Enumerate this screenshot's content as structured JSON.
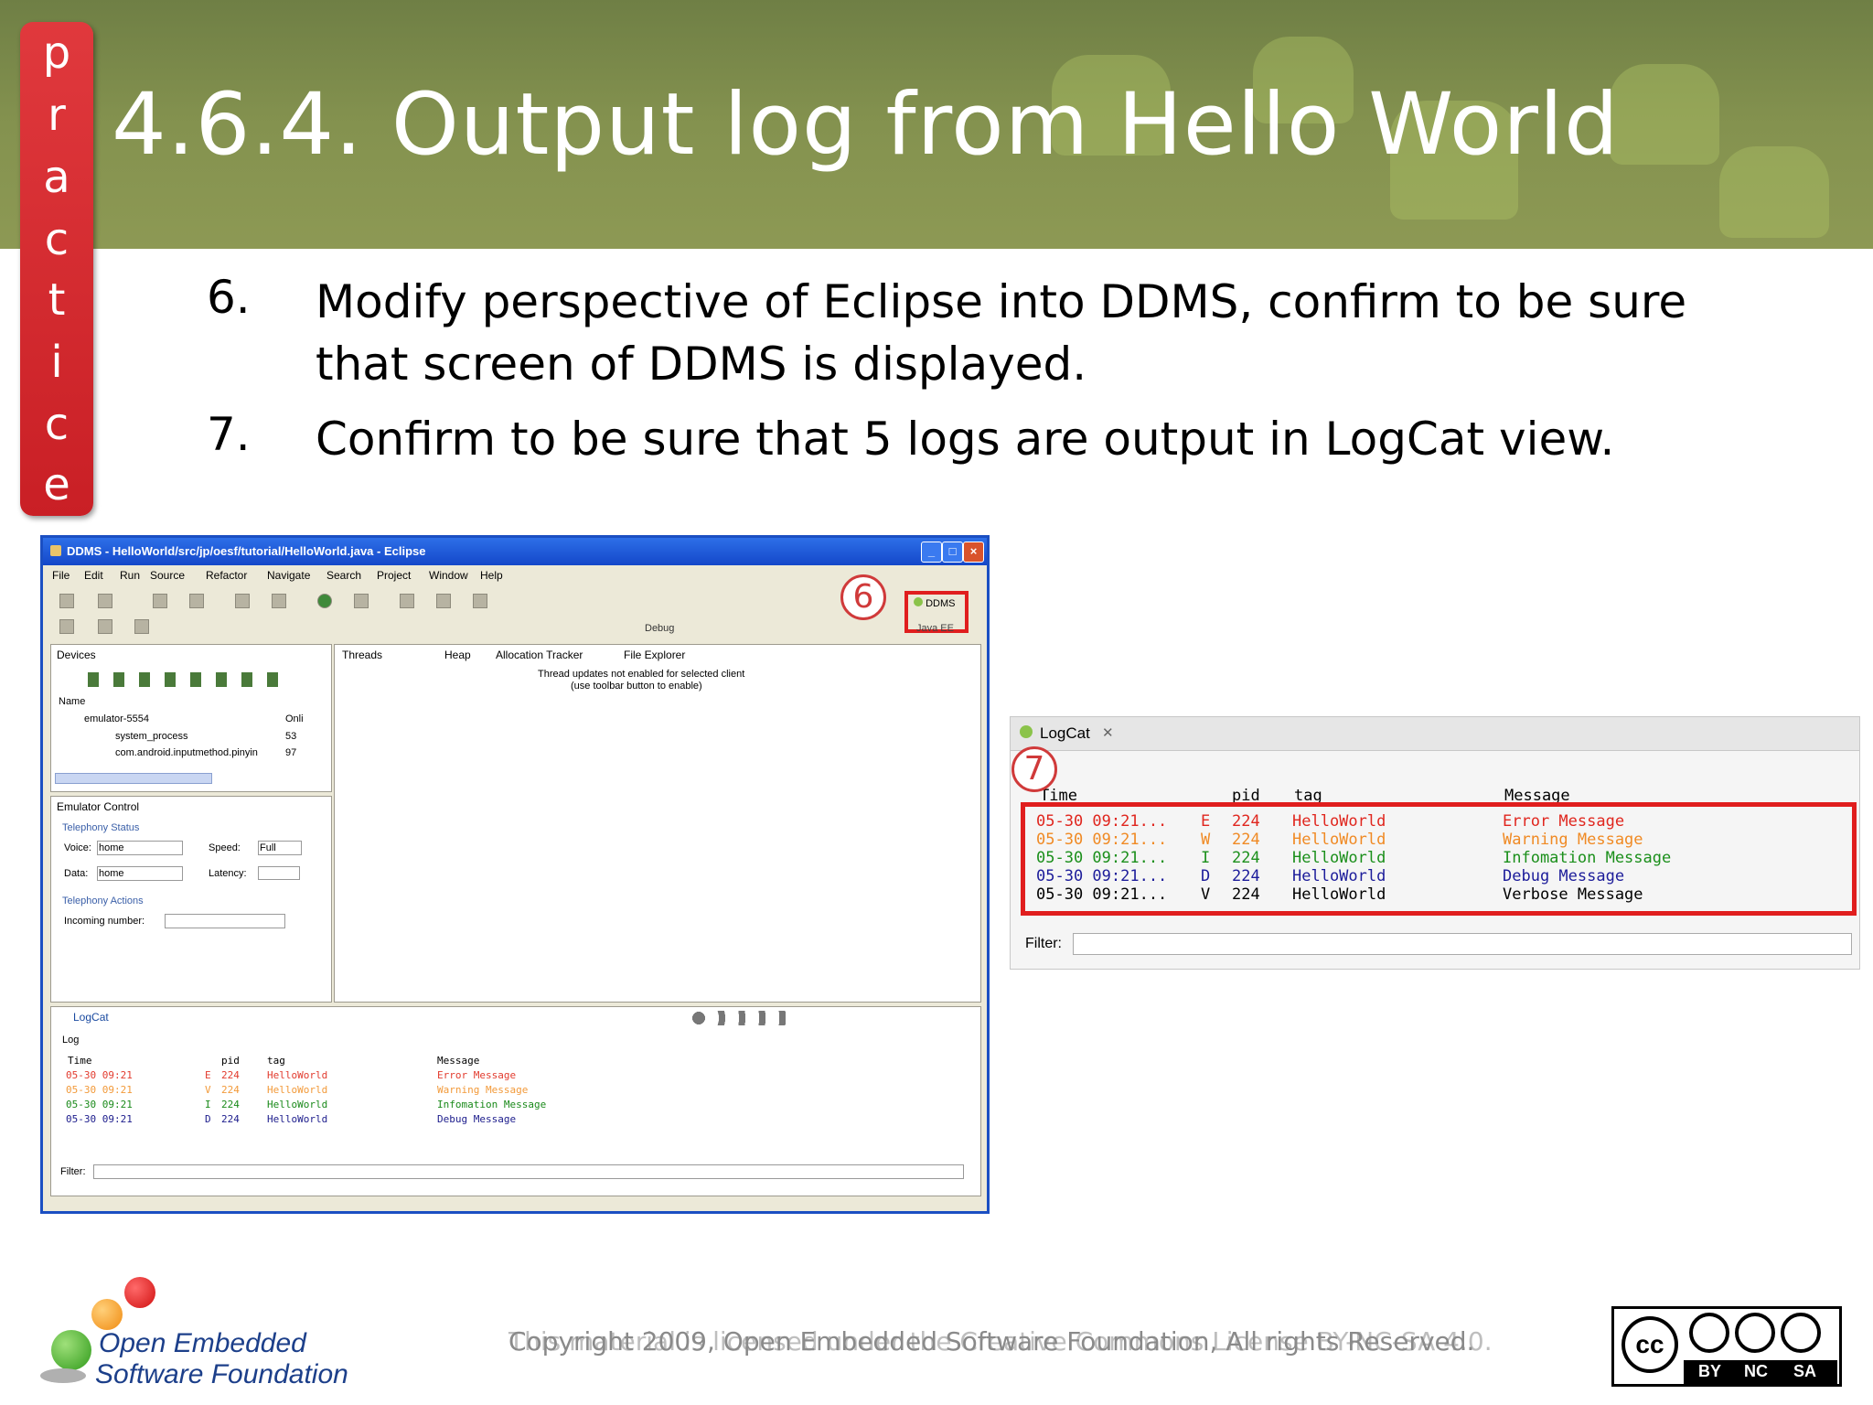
{
  "slide": {
    "title": "4.6.4. Output log from Hello World",
    "practice_letters": [
      "p",
      "r",
      "a",
      "c",
      "t",
      "i",
      "c",
      "e"
    ]
  },
  "steps": [
    {
      "num": "6.",
      "text": "Modify perspective of Eclipse into DDMS, confirm to be sure that screen of DDMS is displayed."
    },
    {
      "num": "7.",
      "text": "Confirm to be sure that 5 logs are output in LogCat view."
    }
  ],
  "eclipse": {
    "title": "DDMS - HelloWorld/src/jp/oesf/tutorial/HelloWorld.java - Eclipse",
    "menu": [
      "File",
      "Edit",
      "Run",
      "Source",
      "Refactor",
      "Navigate",
      "Search",
      "Project",
      "Window",
      "Help"
    ],
    "perspective": {
      "ddms": "DDMS",
      "debug": "Debug",
      "java": "Java EE"
    },
    "devices": {
      "tab": "Devices",
      "col_name": "Name",
      "rows": [
        {
          "name": "emulator-5554",
          "value": "Onli"
        },
        {
          "name": "system_process",
          "value": "53"
        },
        {
          "name": "com.android.inputmethod.pinyin",
          "value": "97"
        }
      ]
    },
    "right_tabs": [
      "Threads",
      "Heap",
      "Allocation Tracker",
      "File Explorer"
    ],
    "threads_msg": [
      "Thread updates not enabled for selected client",
      "(use toolbar button to enable)"
    ],
    "emulator": {
      "tab": "Emulator Control",
      "telephony_status": "Telephony Status",
      "voice_label": "Voice:",
      "voice_value": "home",
      "speed_label": "Speed:",
      "speed_value": "Full",
      "data_label": "Data:",
      "data_value": "home",
      "latency_label": "Latency:",
      "telephony_actions": "Telephony Actions",
      "incoming_label": "Incoming number:"
    },
    "logcat_small": {
      "tab": "LogCat",
      "subtab": "Log",
      "headers": [
        "Time",
        "pid",
        "tag",
        "Message"
      ],
      "rows": [
        {
          "time": "05-30 09:21",
          "level": "E",
          "pid": "224",
          "tag": "HelloWorld",
          "msg": "Error Message",
          "color": "#e23b2e"
        },
        {
          "time": "05-30 09:21",
          "level": "V",
          "pid": "224",
          "tag": "HelloWorld",
          "msg": "Warning Message",
          "color": "#f29a3a"
        },
        {
          "time": "05-30 09:21",
          "level": "I",
          "pid": "224",
          "tag": "HelloWorld",
          "msg": "Infomation Message",
          "color": "#1a8a1a"
        },
        {
          "time": "05-30 09:21",
          "level": "D",
          "pid": "224",
          "tag": "HelloWorld",
          "msg": "Debug Message",
          "color": "#1c1c8c"
        }
      ],
      "filter_label": "Filter:"
    }
  },
  "logcat_zoom": {
    "tab": "LogCat",
    "headers": [
      "Time",
      "pid",
      "tag",
      "Message"
    ],
    "rows": [
      {
        "time": "05-30 09:21...",
        "level": "E",
        "pid": "224",
        "tag": "HelloWorld",
        "msg": "Error Message",
        "color": "#e0261e"
      },
      {
        "time": "05-30 09:21...",
        "level": "W",
        "pid": "224",
        "tag": "HelloWorld",
        "msg": "Warning Message",
        "color": "#f08a24"
      },
      {
        "time": "05-30 09:21...",
        "level": "I",
        "pid": "224",
        "tag": "HelloWorld",
        "msg": "Infomation Message",
        "color": "#1b8f1b"
      },
      {
        "time": "05-30 09:21...",
        "level": "D",
        "pid": "224",
        "tag": "HelloWorld",
        "msg": "Debug Message",
        "color": "#1c1c9a"
      },
      {
        "time": "05-30 09:21...",
        "level": "V",
        "pid": "224",
        "tag": "HelloWorld",
        "msg": "Verbose Message",
        "color": "#000000"
      }
    ],
    "filter_label": "Filter:"
  },
  "markers": {
    "six": "6",
    "seven": "7"
  },
  "footer": {
    "org_line1": "Open Embedded",
    "org_line2": "Software Foundation",
    "copyright": "Copyright 2009, Open Embedded Software Foundation, All rights Reserved.",
    "license": "This material is licensed under the Creative Commons License BY-NC-SA 4.0.",
    "cc": {
      "cc": "cc",
      "by": "BY",
      "nc": "NC",
      "sa": "SA"
    }
  },
  "colors": {
    "highlight_red": "#e01e1e",
    "practice_red": "#d42a2f",
    "header_green": "#84924f"
  }
}
